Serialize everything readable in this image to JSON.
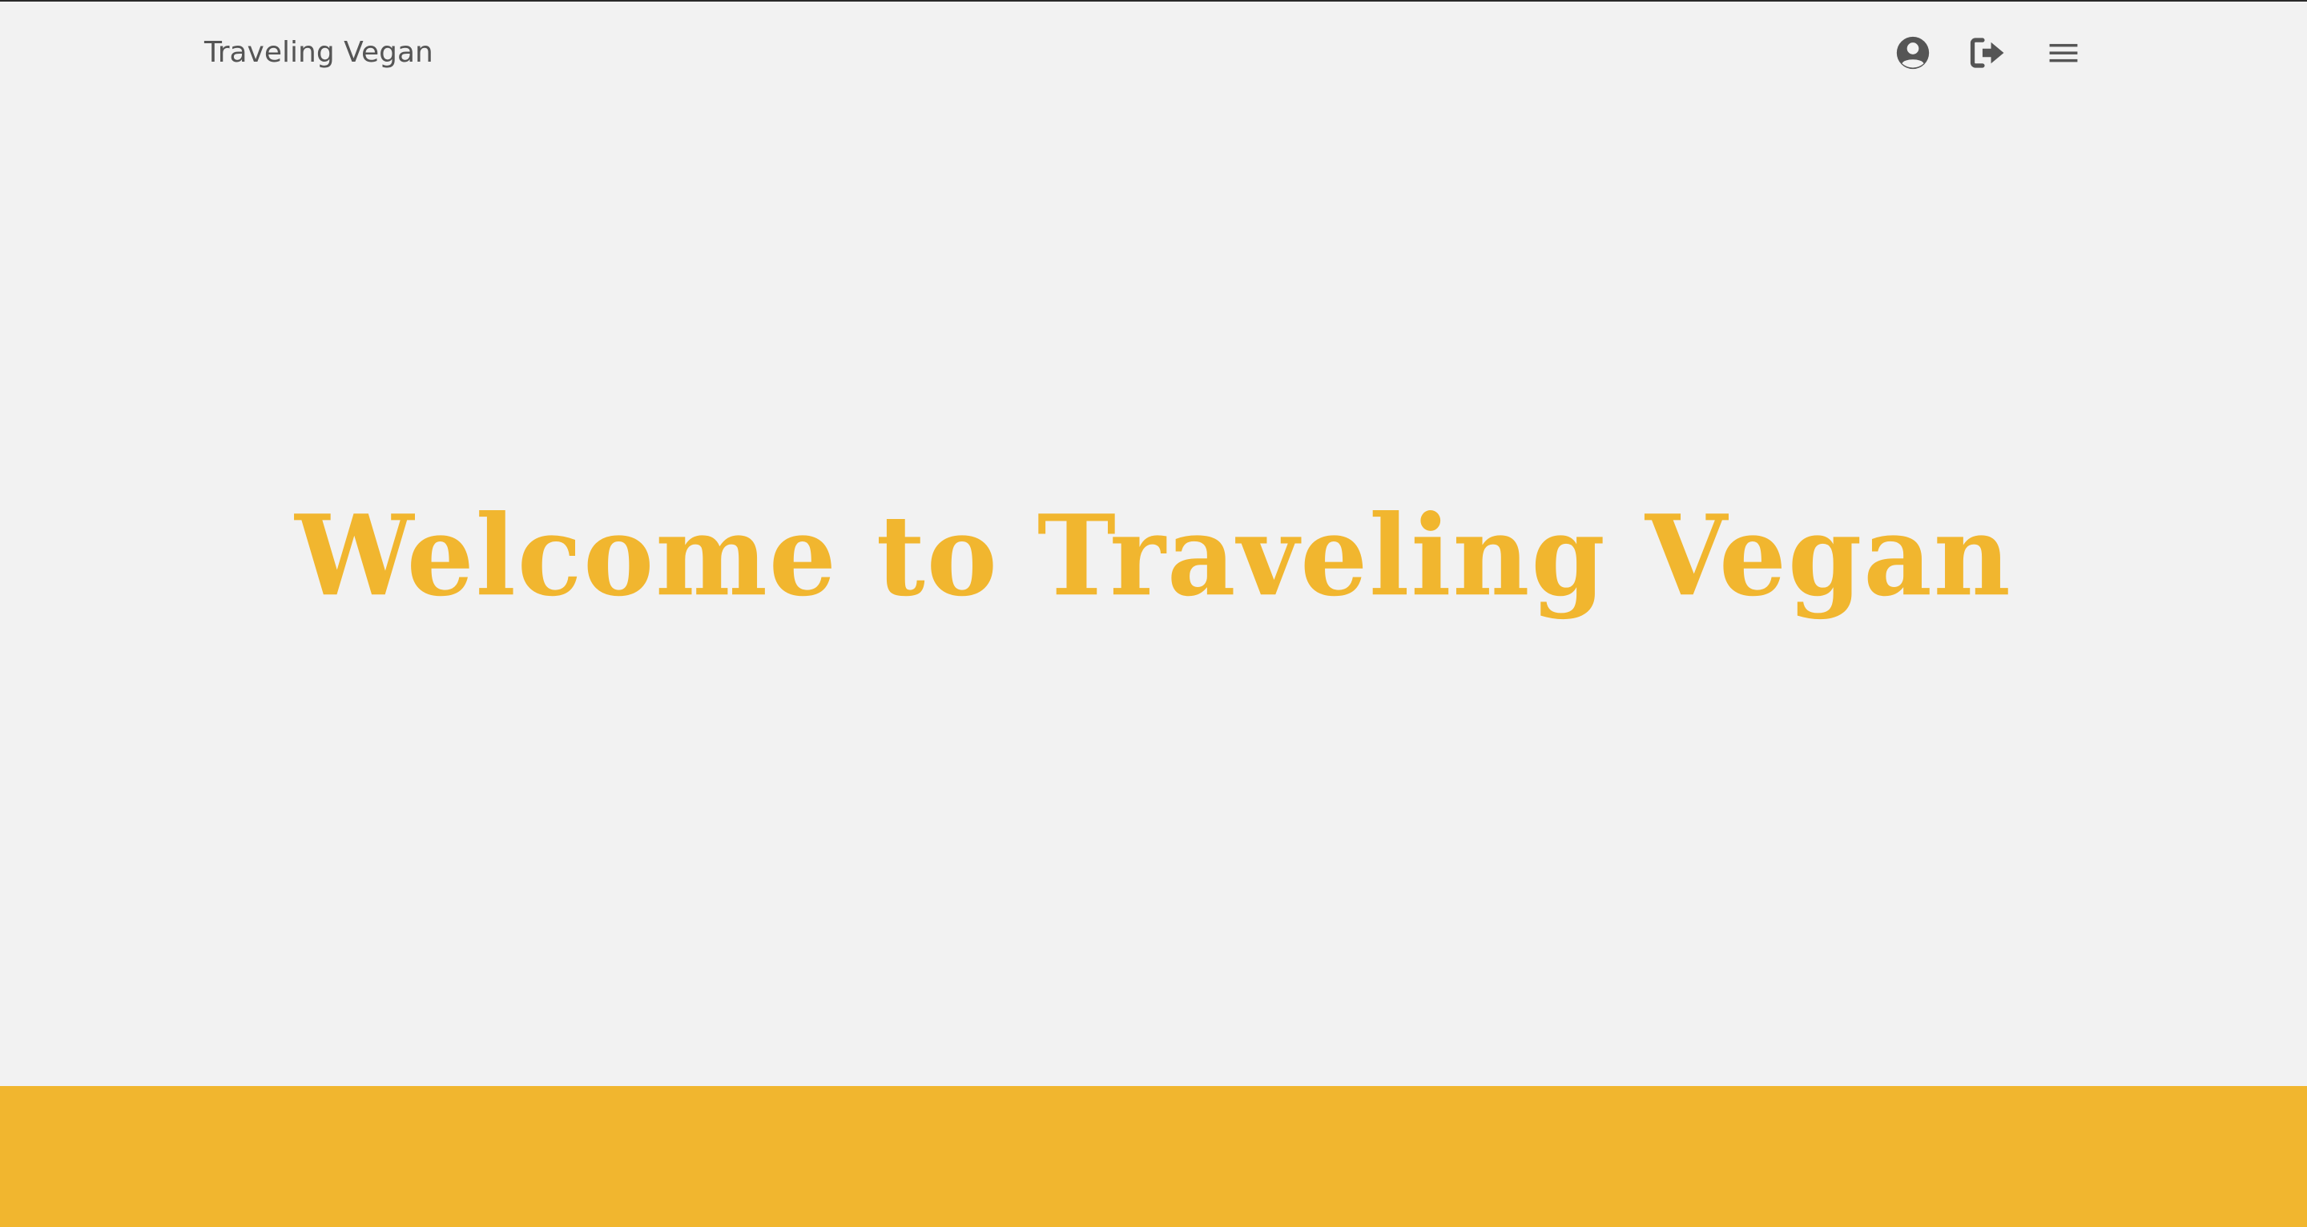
{
  "navbar": {
    "brand": "Traveling Vegan",
    "icons": [
      "account-circle-icon",
      "sign-out-icon",
      "menu-icon"
    ]
  },
  "hero": {
    "title": "Welcome to Traveling Vegan"
  },
  "colors": {
    "background": "#f2f2f2",
    "accent": "#f1b62f",
    "nav_text": "#555555",
    "icon": "#555555"
  }
}
